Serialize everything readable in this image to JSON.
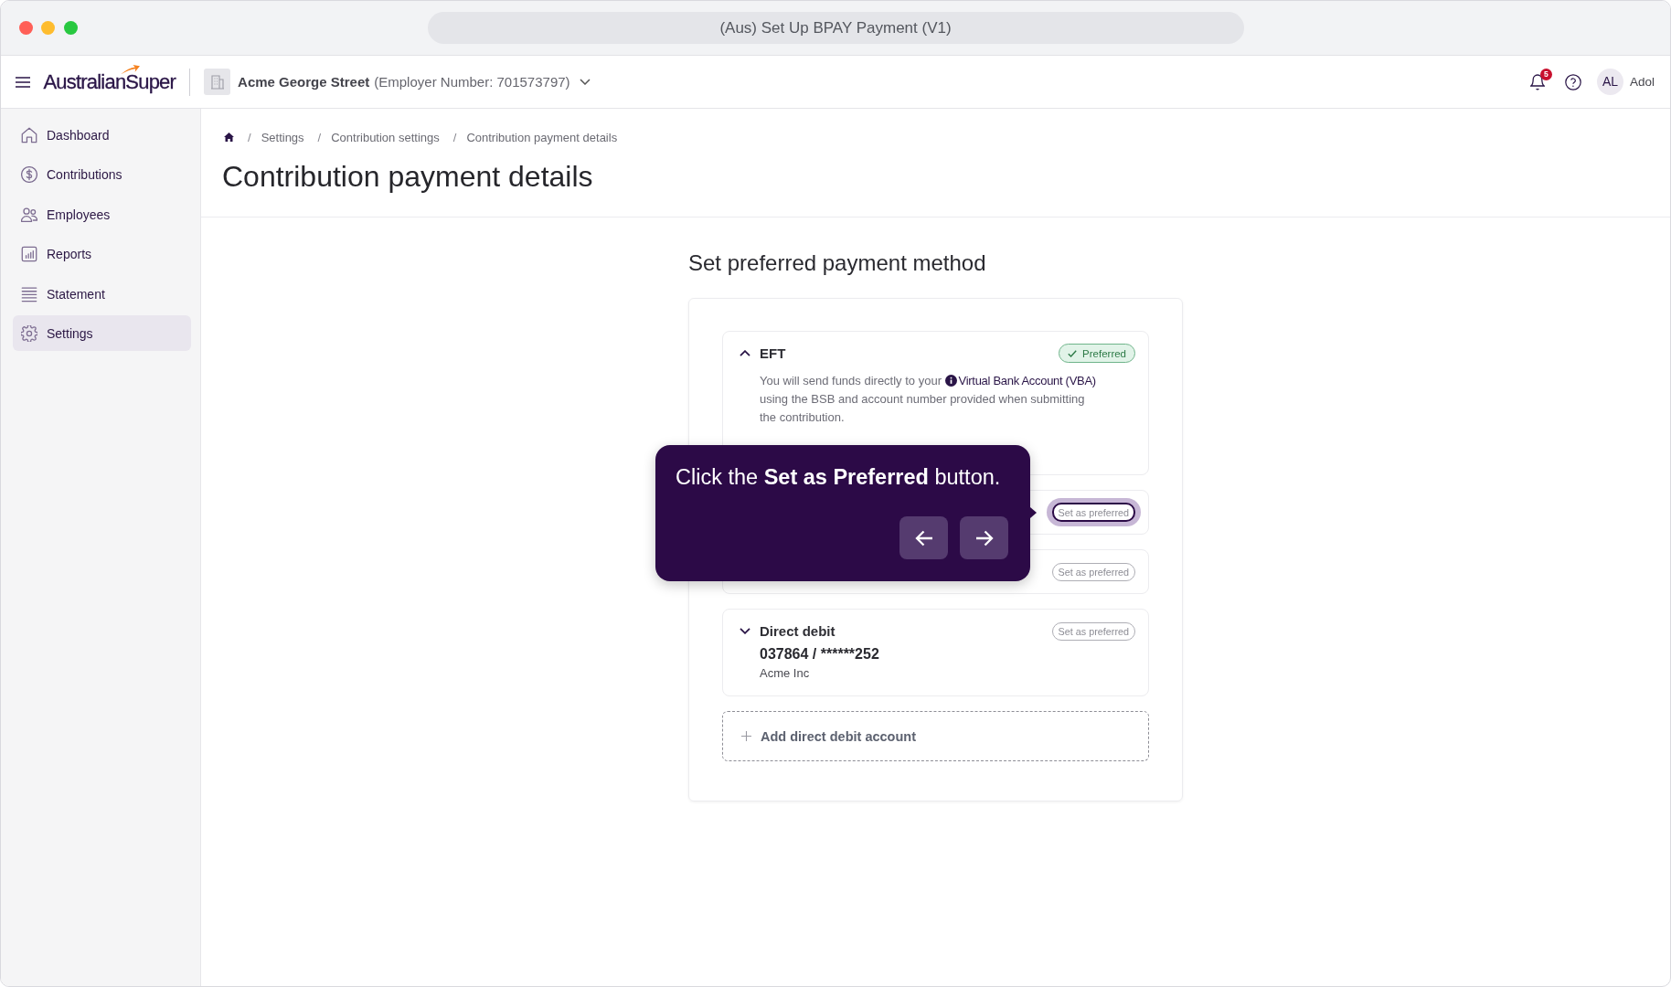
{
  "window": {
    "title": "(Aus) Set Up BPAY Payment (V1)"
  },
  "header": {
    "logo": "AustralianSuper",
    "employer_name": "Acme George Street",
    "employer_number": "(Employer Number: 701573797)",
    "notification_count": "5",
    "avatar_initials": "AL",
    "user_name": "Adol"
  },
  "sidebar": {
    "items": [
      {
        "label": "Dashboard",
        "selected": false
      },
      {
        "label": "Contributions",
        "selected": false
      },
      {
        "label": "Employees",
        "selected": false
      },
      {
        "label": "Reports",
        "selected": false
      },
      {
        "label": "Statement",
        "selected": false
      },
      {
        "label": "Settings",
        "selected": true
      }
    ]
  },
  "breadcrumbs": [
    {
      "separator": "/",
      "label": "Settings"
    },
    {
      "separator": "/",
      "label": "Contribution settings"
    },
    {
      "separator": "/",
      "label": "Contribution payment details"
    }
  ],
  "page_title": "Contribution payment details",
  "section_title": "Set preferred payment method",
  "payment_methods": [
    {
      "title": "EFT",
      "expanded": true,
      "preferred": true,
      "highlighted": false,
      "status": "Preferred",
      "description": {
        "before": "You will send funds directly to your",
        "link": "Virtual Bank Account (VBA)",
        "after": "using the BSB and account number provided when submitting the contribution."
      }
    },
    {
      "preferred": false,
      "highlighted": true,
      "status": "Set as preferred"
    },
    {
      "preferred": false,
      "highlighted": false,
      "status": "Set as preferred"
    },
    {
      "title": "Direct debit",
      "expanded": false,
      "preferred": false,
      "highlighted": false,
      "status": "Set as preferred",
      "account": "037864 / ******252",
      "account_name": "Acme Inc"
    }
  ],
  "add_account": {
    "label": "Add direct debit account"
  },
  "tour_tooltip": {
    "text": "Click the **Set as Preferred** button."
  }
}
